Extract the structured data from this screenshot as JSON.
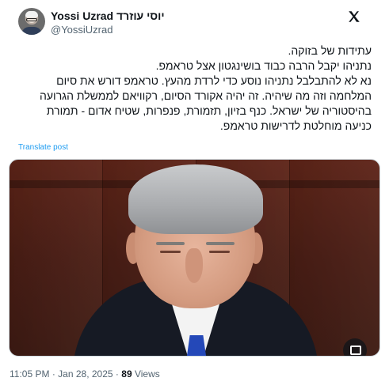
{
  "author": {
    "display_name": "Yossi Uzrad יוסי עוזרד",
    "handle": "@YossiUzrad"
  },
  "post": {
    "text": "עתידות של בזוקה.\nנתניהו יקבל הרבה כבוד בושינגטון אצל טראמפ.\nנא לא להתבלבל נתניהו נוסע כדי לרדת מהעץ.  טראמפ דורש את סיום המלחמה וזה מה שיהיה. זה יהיה אקורד הסיום, רקוויאם לממשלת הגרועה בהיסטוריה של ישראל. כנף בזיון, תזמורת, פנפרות, שטיח אדום - תמורת כניעה מוחלטת לדרישות טראמפ.",
    "translate_label": "Translate post"
  },
  "meta": {
    "time": "11:05 PM",
    "separator": "·",
    "date": "Jan 28, 2025",
    "views_count": "89",
    "views_label": "Views"
  },
  "icons": {
    "platform_logo": "x-logo-icon",
    "media_action": "media-expand-icon"
  },
  "colors": {
    "link": "#1d9bf0",
    "secondary_text": "#536471",
    "primary_text": "#0f1419"
  }
}
